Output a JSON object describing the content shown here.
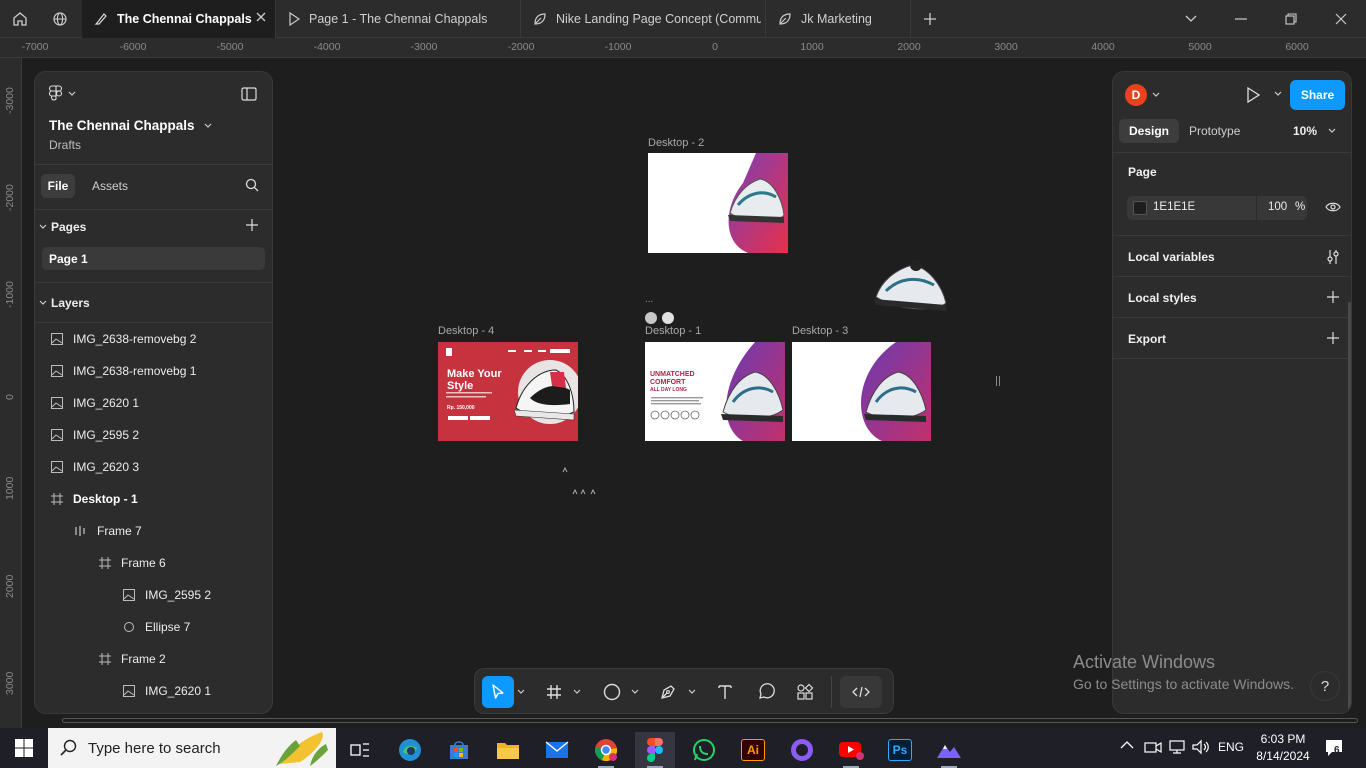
{
  "tabs": [
    {
      "label": "The Chennai Chappals",
      "active": true,
      "icon": "figma-file-icon"
    },
    {
      "label": "Page 1 - The Chennai Chappals",
      "active": false,
      "icon": "prototype-play-icon"
    },
    {
      "label": "Nike Landing Page Concept (Commu",
      "active": false,
      "icon": "community-leaf-icon"
    },
    {
      "label": "Jk Marketing",
      "active": false,
      "icon": "community-leaf-icon"
    }
  ],
  "ruler_top": [
    "-7000",
    "-6000",
    "-5000",
    "-4000",
    "-3000",
    "-2000",
    "-1000",
    "0",
    "1000",
    "2000",
    "3000",
    "4000",
    "5000",
    "6000"
  ],
  "ruler_left": [
    "-3000",
    "-2000",
    "-1000",
    "0",
    "1000",
    "2000",
    "3000"
  ],
  "left_panel": {
    "file_name": "The Chennai Chappals",
    "location": "Drafts",
    "tab_file": "File",
    "tab_assets": "Assets",
    "pages_heading": "Pages",
    "pages": [
      "Page 1"
    ],
    "layers_heading": "Layers",
    "layers": [
      {
        "name": "IMG_2638-removebg 2",
        "icon": "image-icon",
        "indent": 0
      },
      {
        "name": "IMG_2638-removebg 1",
        "icon": "image-icon",
        "indent": 0
      },
      {
        "name": "IMG_2620 1",
        "icon": "image-icon",
        "indent": 0
      },
      {
        "name": "IMG_2595 2",
        "icon": "image-icon",
        "indent": 0
      },
      {
        "name": "IMG_2620 3",
        "icon": "image-icon",
        "indent": 0
      },
      {
        "name": "Desktop - 1",
        "icon": "frame-icon",
        "indent": 0,
        "bold": true
      },
      {
        "name": "Frame 7",
        "icon": "auto-layout-icon",
        "indent": 1
      },
      {
        "name": "Frame 6",
        "icon": "frame-icon",
        "indent": 2
      },
      {
        "name": "IMG_2595 2",
        "icon": "image-icon",
        "indent": 3
      },
      {
        "name": "Ellipse 7",
        "icon": "ellipse-icon",
        "indent": 3
      },
      {
        "name": "Frame 2",
        "icon": "frame-icon",
        "indent": 2
      },
      {
        "name": "IMG_2620 1",
        "icon": "image-icon",
        "indent": 3
      }
    ]
  },
  "right_panel": {
    "avatar_letter": "D",
    "share_label": "Share",
    "tab_design": "Design",
    "tab_prototype": "Prototype",
    "zoom": "10%",
    "page_heading": "Page",
    "page_color_hex": "1E1E1E",
    "page_opacity": "100",
    "percent_sign": "%",
    "local_variables": "Local variables",
    "local_styles": "Local styles",
    "export": "Export"
  },
  "canvas": {
    "frames": [
      {
        "label": "Desktop - 2"
      },
      {
        "label": "Desktop - 4"
      },
      {
        "label": "Desktop - 1"
      },
      {
        "label": "Desktop - 3"
      }
    ],
    "desktop4_headline": "Make Your Style",
    "desktop4_price": "Rp. 150,000",
    "desktop1_headline": "UNMATCHED COMFORT",
    "desktop1_sub": "ALL DAY LONG",
    "ellipsis": "...",
    "activate_title": "Activate Windows",
    "activate_sub": "Go to Settings to activate Windows."
  },
  "taskbar": {
    "search_placeholder": "Type here to search",
    "language": "ENG",
    "time": "6:03 PM",
    "date": "8/14/2024",
    "notification_count": "6"
  },
  "colors": {
    "accent": "#0d99ff",
    "avatar": "#e8431e",
    "canvas_bg": "#1e1e1e",
    "panel_bg": "#2c2c2c"
  }
}
